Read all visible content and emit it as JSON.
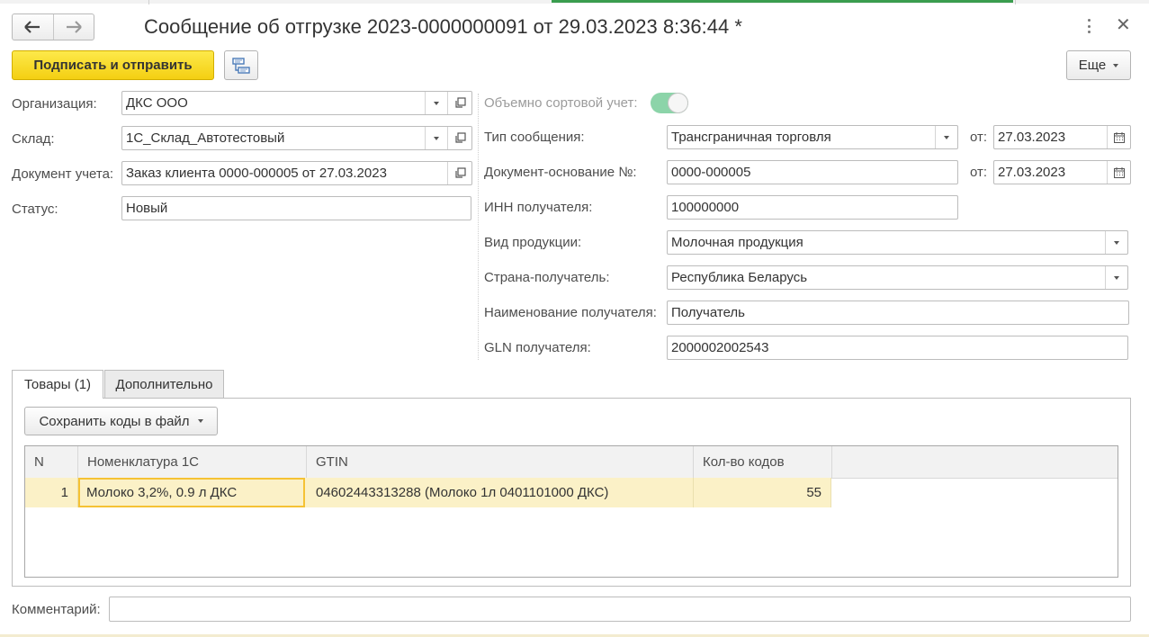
{
  "window": {
    "title": "Сообщение об отгрузке 2023-0000000091 от 29.03.2023 8:36:44 *"
  },
  "toolbar": {
    "sign_send_label": "Подписать и отправить",
    "more_label": "Еще"
  },
  "left_form": {
    "organization": {
      "label": "Организация:",
      "value": "ДКС ООО"
    },
    "warehouse": {
      "label": "Склад:",
      "value": "1С_Склад_Автотестовый"
    },
    "accounting_doc": {
      "label": "Документ учета:",
      "value": "Заказ клиента 0000-000005 от 27.03.2023"
    },
    "status": {
      "label": "Статус:",
      "value": "Новый"
    }
  },
  "right_form": {
    "volume_sort": {
      "label": "Объемно сортовой учет:",
      "enabled": true
    },
    "message_type": {
      "label": "Тип сообщения:",
      "value": "Трансграничная торговля",
      "date_label": "от:",
      "date": "27.03.2023"
    },
    "base_doc": {
      "label": "Документ-основание №:",
      "value": "0000-000005",
      "date_label": "от:",
      "date": "27.03.2023"
    },
    "inn": {
      "label": "ИНН получателя:",
      "value": "100000000"
    },
    "product_type": {
      "label": "Вид продукции:",
      "value": "Молочная продукция"
    },
    "country": {
      "label": "Страна-получатель:",
      "value": "Республика Беларусь"
    },
    "recipient_name": {
      "label": "Наименование получателя:",
      "value": "Получатель"
    },
    "gln": {
      "label": "GLN получателя:",
      "value": "2000002002543"
    }
  },
  "tabs": [
    {
      "label": "Товары (1)",
      "active": true
    },
    {
      "label": "Дополнительно",
      "active": false
    }
  ],
  "goods": {
    "save_codes_label": "Сохранить коды в файл",
    "columns": [
      "N",
      "Номенклатура 1С",
      "GTIN",
      "Кол-во кодов"
    ],
    "rows": [
      {
        "n": "1",
        "nomenclature": "Молоко 3,2%, 0.9 л ДКС",
        "gtin": "04602443313288 (Молоко 1л 0401101000 ДКС)",
        "count": "55"
      }
    ]
  },
  "comment": {
    "label": "Комментарий:",
    "value": ""
  },
  "colors": {
    "primary_button": "#f4cf12",
    "toggle_on": "#8cd4a9",
    "row_highlight": "#fbf1c7",
    "selected_cell_border": "#f5c234",
    "active_window_line": "#3a9d4f"
  }
}
